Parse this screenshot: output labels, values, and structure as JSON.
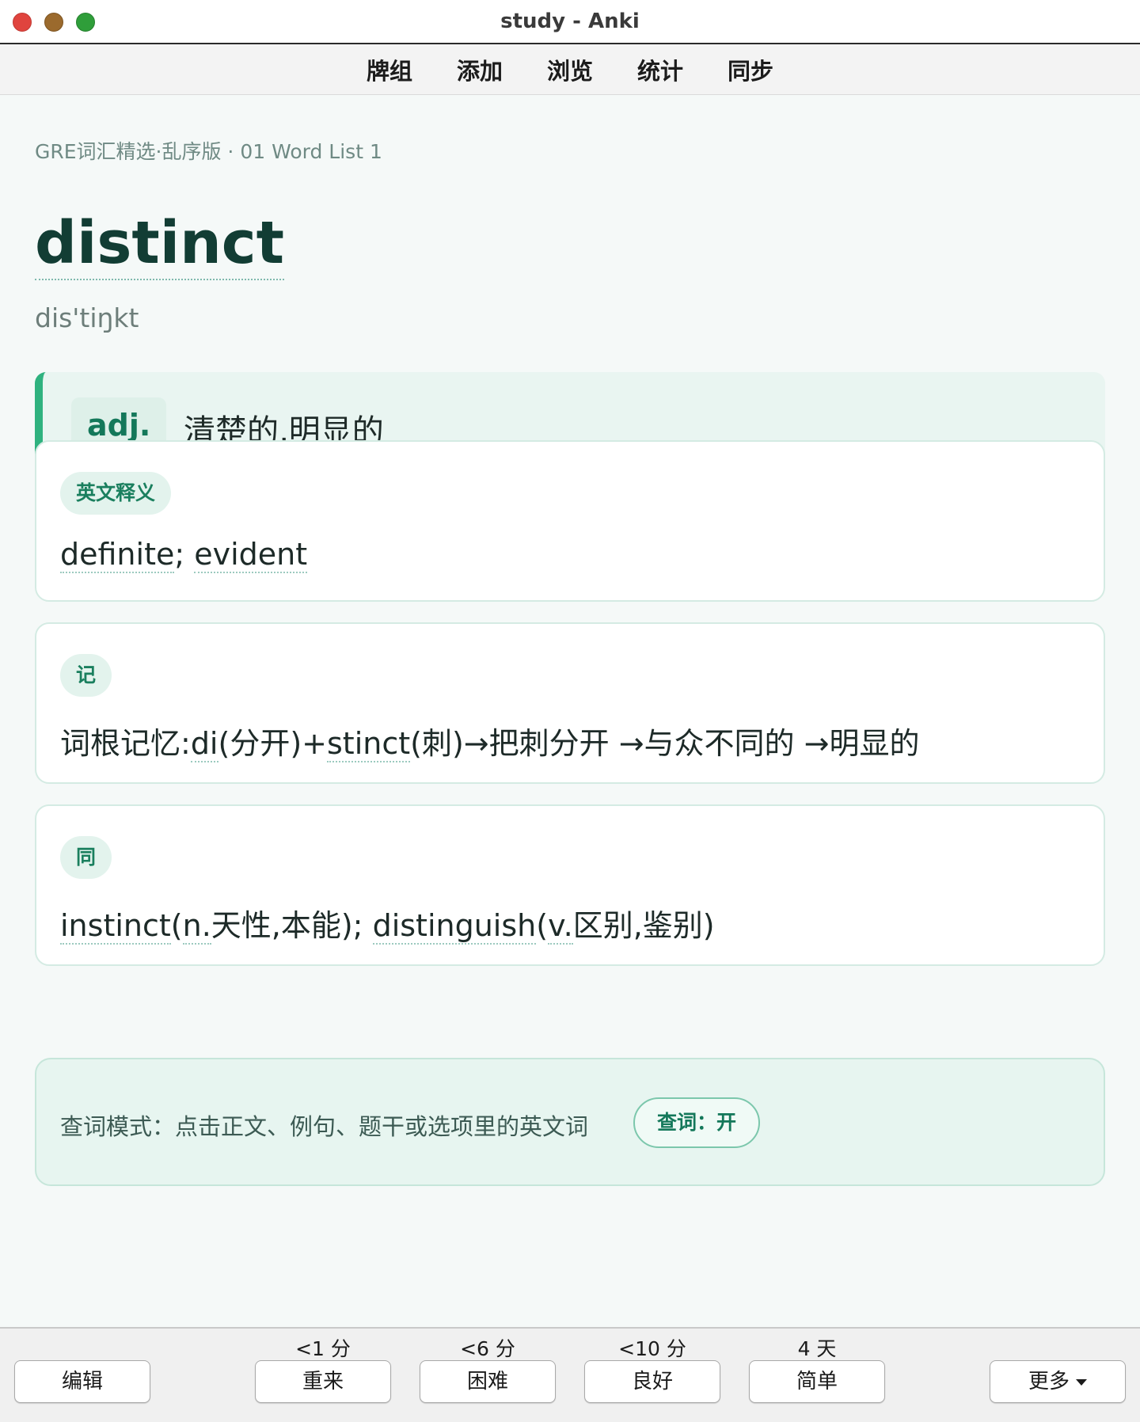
{
  "window": {
    "title": "study - Anki"
  },
  "toolbar": {
    "items": [
      "牌组",
      "添加",
      "浏览",
      "统计",
      "同步"
    ]
  },
  "card": {
    "deck_path": "GRE词汇精选·乱序版 · 01 Word List 1",
    "word": "distinct",
    "phonetic": "dis'tiŋkt",
    "pos": "adj.",
    "definition": "清楚的,明显的",
    "sections": [
      {
        "tag": "英文释义",
        "parts": [
          "definite",
          "; ",
          "evident"
        ]
      },
      {
        "tag": "记",
        "parts": [
          "词根记忆:",
          "di",
          "(分开)+",
          "stinct",
          "(刺)→把刺分开 →与众不同的 →明显的"
        ]
      },
      {
        "tag": "同",
        "parts": [
          "instinct",
          "(",
          "n.",
          "天性,本能); ",
          "distinguish",
          "(",
          "v.",
          "区别,鉴别)"
        ]
      }
    ],
    "lookup": {
      "text": "查词模式：点击正文、例句、题干或选项里的英文词",
      "toggle_label": "查词：开"
    }
  },
  "bottom": {
    "edit_label": "编辑",
    "more_label": "更多",
    "answers": [
      {
        "due": "<1 分",
        "label": "重来"
      },
      {
        "due": "<6 分",
        "label": "困难"
      },
      {
        "due": "<10 分",
        "label": "良好"
      },
      {
        "due": "4 天",
        "label": "简单"
      }
    ]
  }
}
